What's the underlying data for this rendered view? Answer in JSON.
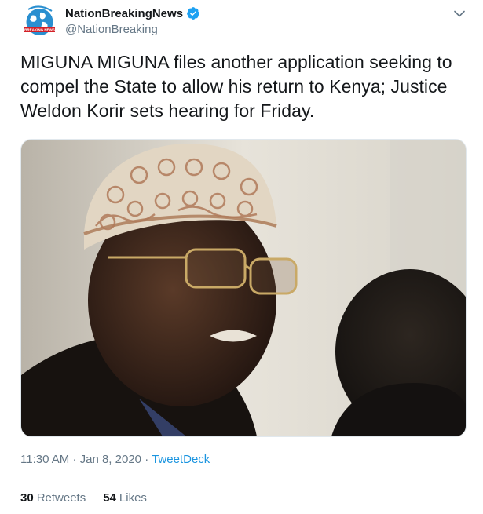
{
  "author": {
    "display_name": "NationBreakingNews",
    "handle": "@NationBreaking",
    "verified": true,
    "avatar_icon": "globe-logo-icon"
  },
  "tweet": {
    "text": "MIGUNA MIGUNA files another application seeking to compel the State to allow his return to Kenya; Justice Weldon Korir sets hearing for Friday.",
    "time": "11:30 AM",
    "date": "Jan 8, 2020",
    "source": "TweetDeck",
    "separator": "·"
  },
  "stats": {
    "retweets_count": "30",
    "retweets_label": "Retweets",
    "likes_count": "54",
    "likes_label": "Likes"
  },
  "colors": {
    "text": "#14171a",
    "muted": "#657786",
    "link": "#1b95e0",
    "verified": "#1da1f2"
  }
}
